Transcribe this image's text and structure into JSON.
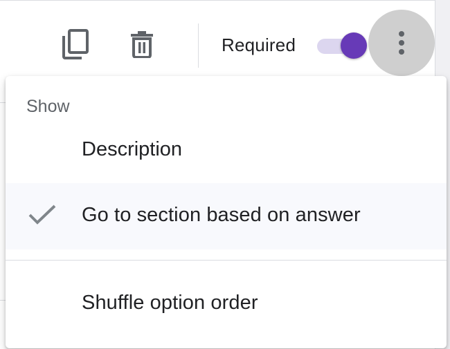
{
  "toolbar": {
    "copy_icon": "duplicate-icon",
    "delete_icon": "trash-icon",
    "required_label": "Required",
    "required_on": true,
    "more_icon": "vertical-dots-icon",
    "accent_color": "#673ab7"
  },
  "menu": {
    "section_label": "Show",
    "items": [
      {
        "label": "Description",
        "checked": false
      },
      {
        "label": "Go to section based on answer",
        "checked": true
      },
      {
        "label": "Shuffle option order",
        "checked": false
      }
    ]
  }
}
